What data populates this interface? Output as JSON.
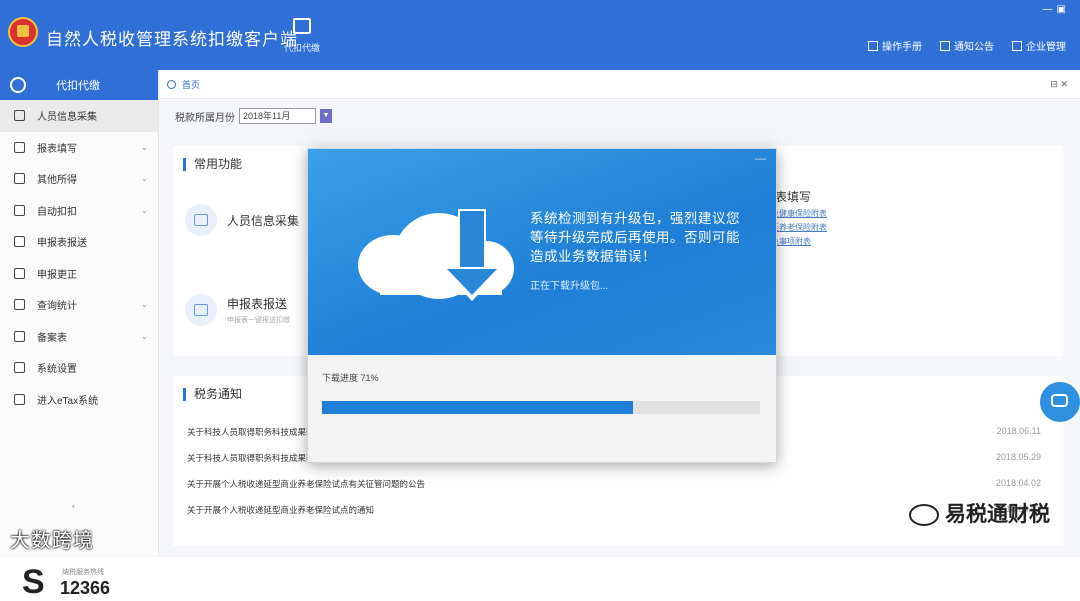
{
  "header": {
    "app_title": "自然人税收管理系统扣缴客户端",
    "tab_label": "代扣代缴",
    "links": [
      "操作手册",
      "通知公告",
      "企业管理"
    ],
    "window_controls": "—▣"
  },
  "sidebar": {
    "title": "代扣代缴",
    "items": [
      {
        "label": "人员信息采集",
        "icon": "person-icon",
        "expand": false,
        "active": true
      },
      {
        "label": "报表填写",
        "icon": "edit-icon",
        "expand": true
      },
      {
        "label": "其他所得",
        "icon": "grid-icon",
        "expand": true
      },
      {
        "label": "自动扣扣",
        "icon": "settings-icon",
        "expand": true
      },
      {
        "label": "申报表报送",
        "icon": "document-icon",
        "expand": false
      },
      {
        "label": "申报更正",
        "icon": "search-icon",
        "expand": false
      },
      {
        "label": "查询统计",
        "icon": "stats-icon",
        "expand": true
      },
      {
        "label": "备案表",
        "icon": "file-icon",
        "expand": true
      },
      {
        "label": "系统设置",
        "icon": "gear-icon",
        "expand": false
      },
      {
        "label": "进入eTax系统",
        "icon": "link-icon",
        "expand": false
      }
    ],
    "dot": "•",
    "hotline_small": "纳税服务热线",
    "hotline_number": "12366",
    "hotline_mark": "S"
  },
  "watermark_left": "大数跨境",
  "watermark_right": "易税通财税",
  "content": {
    "breadcrumb": "首页",
    "breadcrumb_right": "⊟ ✕",
    "period_label": "税款所属月份",
    "period_value": "2018年11月",
    "period_dropdown": "▼",
    "common_title": "常用功能",
    "cards": [
      {
        "title": "人员信息采集",
        "sub": ""
      },
      {
        "title": "申报表报送",
        "sub": "申报表一键报送扣缴"
      }
    ],
    "attach": {
      "title": "附表填写",
      "links": [
        "商业健康保险附表",
        "税延养老保险附表",
        "减免事项附表"
      ]
    },
    "news_title": "税务通知",
    "news": [
      {
        "text": "关于科技人员取得职务科技成果转化现金奖励",
        "date": "2018.06.11"
      },
      {
        "text": "关于科技人员取得职务科技成果转化现金奖励",
        "date": "2018.05.29"
      },
      {
        "text": "关于开展个人税收递延型商业养老保险试点有关征管问题的公告",
        "date": "2018.04.02"
      },
      {
        "text": "关于开展个人税收递延型商业养老保险试点的通知",
        "date": "2018.04.02"
      }
    ]
  },
  "dialog": {
    "close": "—",
    "message": "系统检测到有升级包，强烈建议您等待升级完成后再使用。否则可能造成业务数据错误！",
    "status": "正在下载升级包...",
    "progress_label": "下载进度 71%",
    "progress_value": 71
  }
}
